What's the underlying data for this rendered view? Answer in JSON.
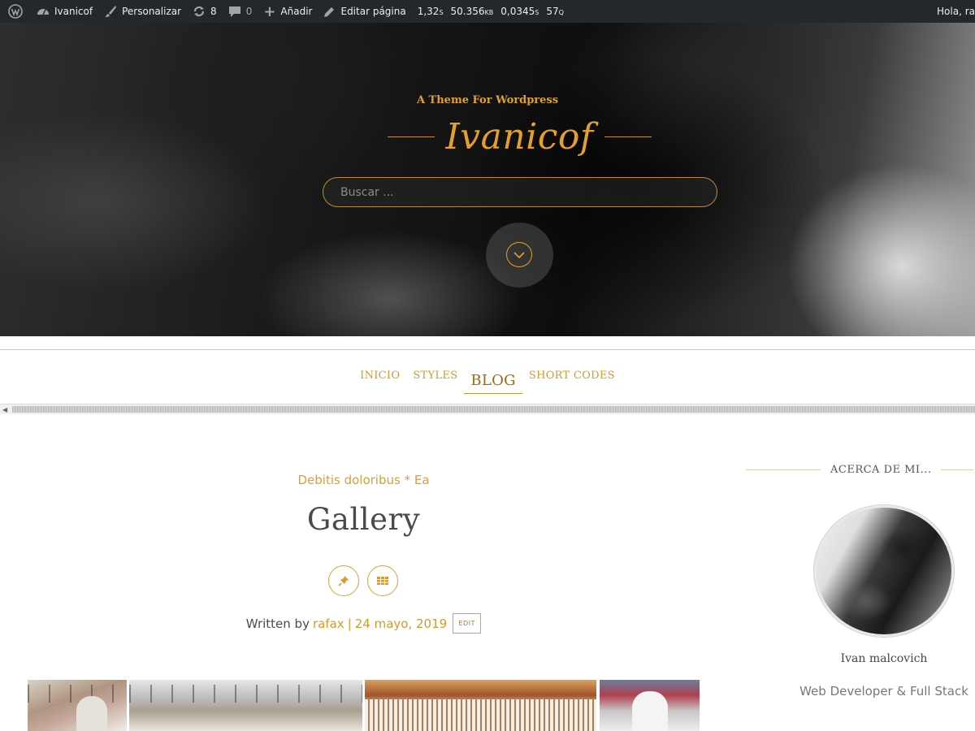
{
  "admin_bar": {
    "site_name": "Ivanicof",
    "customize": "Personalizar",
    "updates_count": "8",
    "comments_count": "0",
    "add_new": "Añadir",
    "edit_page": "Editar página",
    "stats": [
      "1,32s",
      "50.356kb",
      "0,0345s",
      "57q"
    ],
    "greeting": "Hola, ra"
  },
  "hero": {
    "tagline": "A Theme For Wordpress",
    "site_title": "Ivanicof",
    "search_placeholder": "Buscar ..."
  },
  "nav": {
    "items": [
      "INICIO",
      "STYLES",
      "BLOG",
      "SHORT CODES"
    ],
    "active": "BLOG"
  },
  "post": {
    "category": "Debitis doloribus * Ea",
    "title": "Gallery",
    "written_by": "Written by",
    "author": "rafax",
    "separator": "|",
    "date": "24 mayo, 2019",
    "edit_label": "EDIT"
  },
  "sidebar": {
    "widget_title": "ACERCA DE MI...",
    "name": "Ivan malcovich",
    "role": "Web Developer & Full Stack"
  },
  "colors": {
    "accent": "#d39a2b",
    "admin_bar": "#23282d"
  }
}
